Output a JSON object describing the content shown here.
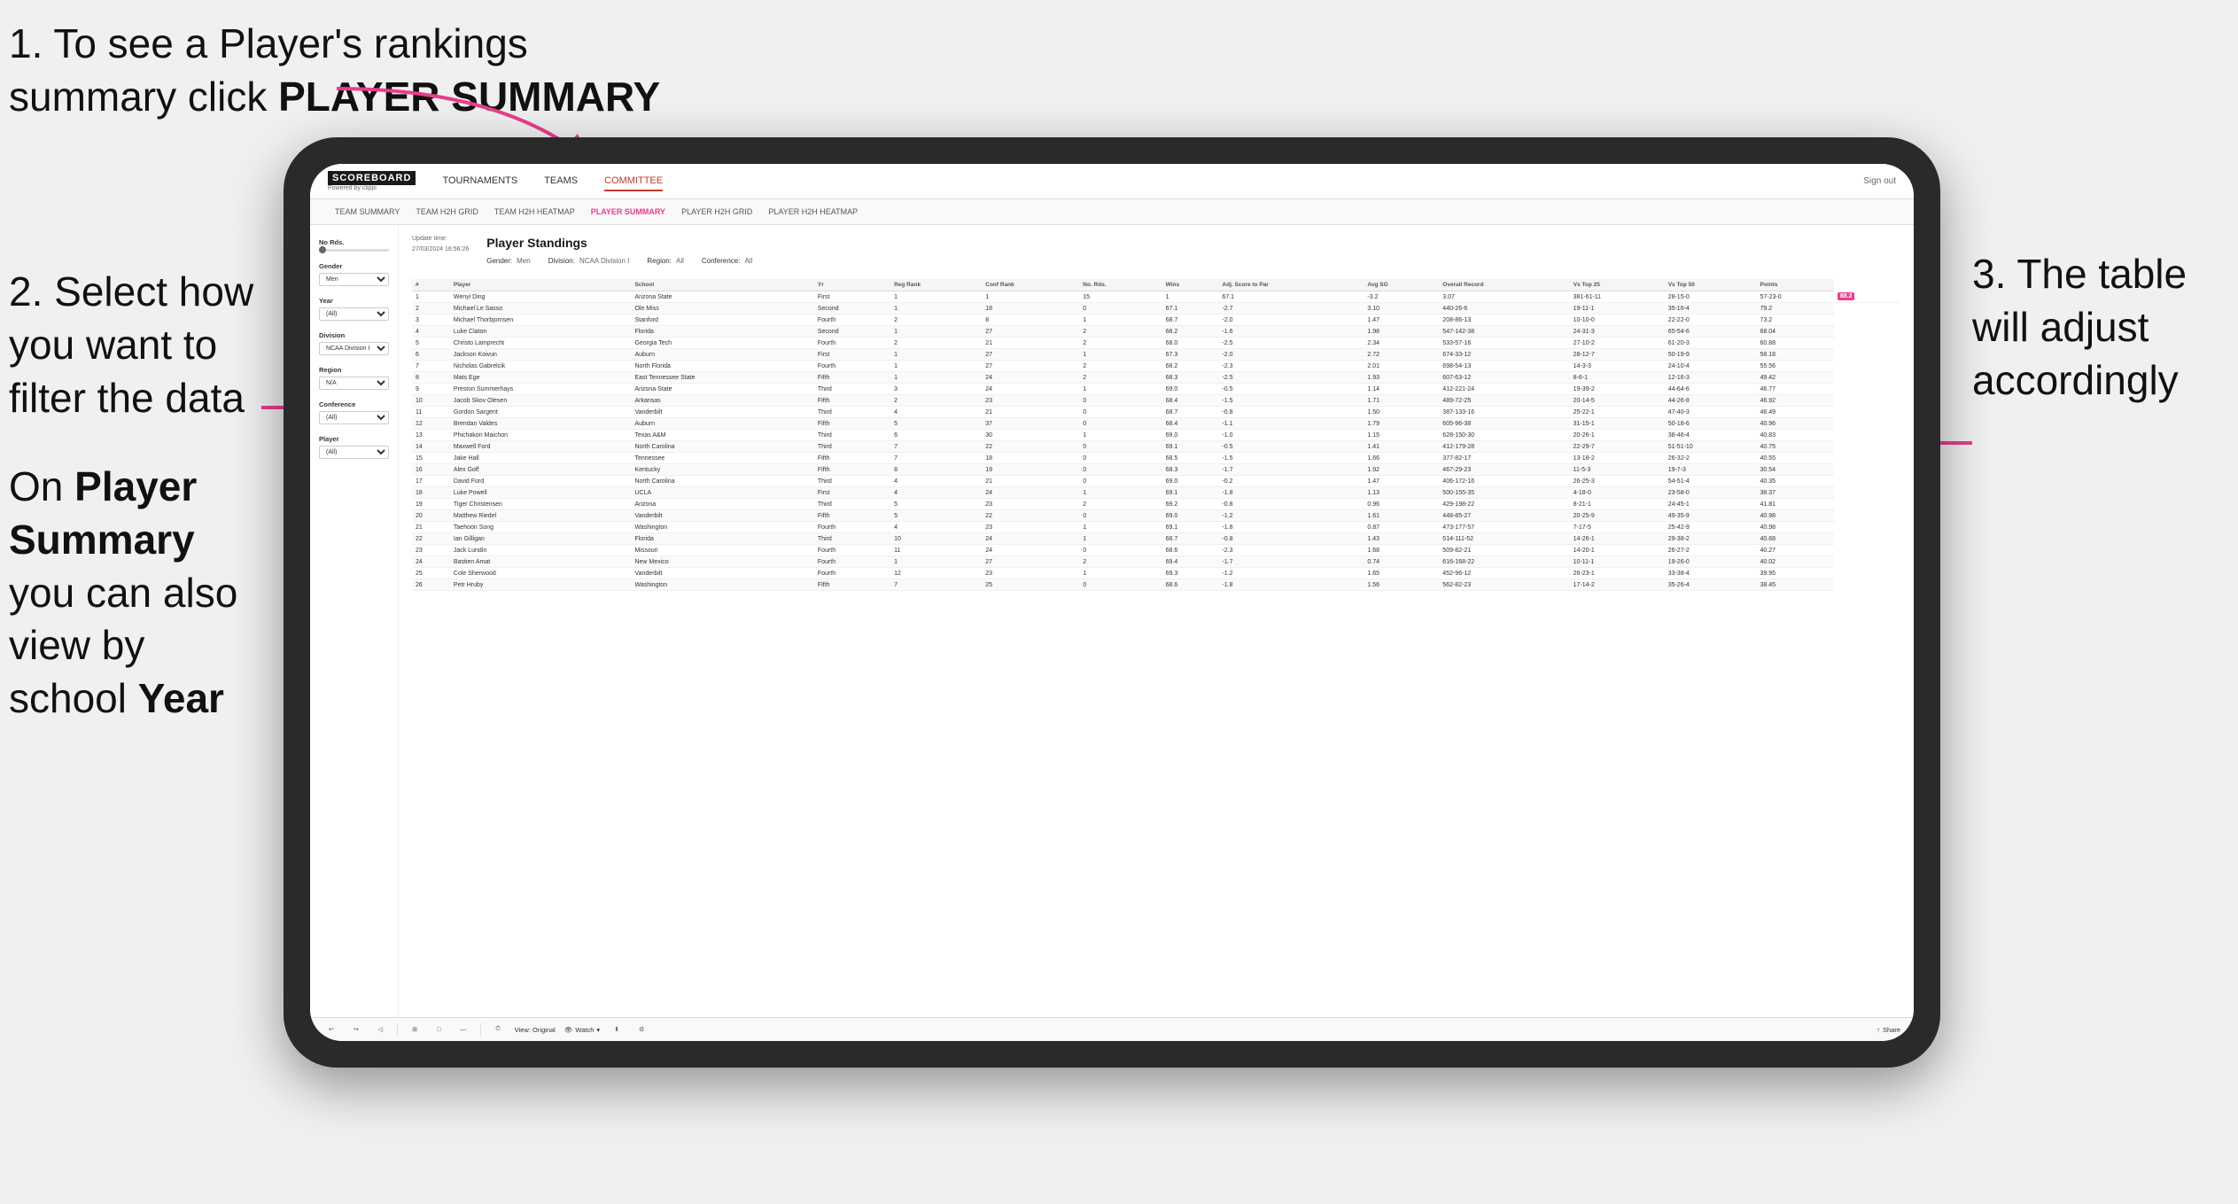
{
  "annotations": {
    "step1": "1. To see a Player's rankings summary click ",
    "step1_bold": "PLAYER SUMMARY",
    "step2_title": "2. Select how you want to filter the data",
    "step3_title": "3. The table will adjust accordingly",
    "bottom_note_prefix": "On ",
    "bottom_note_bold1": "Player Summary",
    "bottom_note_mid": " you can also view by school ",
    "bottom_note_bold2": "Year"
  },
  "nav": {
    "logo": "SCOREBOARD",
    "logo_sub": "Powered by clippi",
    "links": [
      "TOURNAMENTS",
      "TEAMS",
      "COMMITTEE"
    ],
    "sign_out": "Sign out"
  },
  "subnav": {
    "links": [
      "TEAM SUMMARY",
      "TEAM H2H GRID",
      "TEAM H2H HEATMAP",
      "PLAYER SUMMARY",
      "PLAYER H2H GRID",
      "PLAYER H2H HEATMAP"
    ]
  },
  "sidebar": {
    "no_rds_label": "No Rds.",
    "gender_label": "Gender",
    "gender_value": "Men",
    "year_label": "Year",
    "year_value": "(All)",
    "division_label": "Division",
    "division_value": "NCAA Division I",
    "region_label": "Region",
    "region_value": "N/A",
    "conference_label": "Conference",
    "conference_value": "(All)",
    "player_label": "Player",
    "player_value": "(All)"
  },
  "table": {
    "update_time": "Update time:",
    "update_date": "27/03/2024 16:56:26",
    "title": "Player Standings",
    "filters": {
      "gender_label": "Gender:",
      "gender_val": "Men",
      "division_label": "Division:",
      "division_val": "NCAA Division I",
      "region_label": "Region:",
      "region_val": "All",
      "conference_label": "Conference:",
      "conference_val": "All"
    },
    "columns": [
      "#",
      "Player",
      "School",
      "Yr",
      "Reg Rank",
      "Conf Rank",
      "No. Rds.",
      "Wins",
      "Adj. Score to Par",
      "Avg SG",
      "Overall Record",
      "Vs Top 25",
      "Vs Top 50",
      "Points"
    ],
    "rows": [
      [
        "1",
        "Wenyi Ding",
        "Arizona State",
        "First",
        "1",
        "1",
        "15",
        "1",
        "67.1",
        "-3.2",
        "3.07",
        "381-61-11",
        "28-15-0",
        "57-23-0",
        "88.2"
      ],
      [
        "2",
        "Michael Le Sasso",
        "Ole Miss",
        "Second",
        "1",
        "18",
        "0",
        "67.1",
        "-2.7",
        "3.10",
        "440-26-6",
        "19-11-1",
        "35-16-4",
        "79.2"
      ],
      [
        "3",
        "Michael Thorbjornsen",
        "Stanford",
        "Fourth",
        "2",
        "8",
        "1",
        "68.7",
        "-2.0",
        "1.47",
        "208-86-13",
        "10-10-0",
        "22-22-0",
        "73.2"
      ],
      [
        "4",
        "Luke Claton",
        "Florida",
        "Second",
        "1",
        "27",
        "2",
        "68.2",
        "-1.6",
        "1.98",
        "547-142-38",
        "24-31-3",
        "65-54-6",
        "68.04"
      ],
      [
        "5",
        "Christo Lamprecht",
        "Georgia Tech",
        "Fourth",
        "2",
        "21",
        "2",
        "68.0",
        "-2.5",
        "2.34",
        "533-57-16",
        "27-10-2",
        "61-20-3",
        "60.88"
      ],
      [
        "6",
        "Jackson Koivun",
        "Auburn",
        "First",
        "1",
        "27",
        "1",
        "67.3",
        "-2.0",
        "2.72",
        "674-33-12",
        "28-12-7",
        "50-19-9",
        "58.18"
      ],
      [
        "7",
        "Nicholas Gabrelcik",
        "North Florida",
        "Fourth",
        "1",
        "27",
        "2",
        "68.2",
        "-2.3",
        "2.01",
        "698-54-13",
        "14-3-3",
        "24-10-4",
        "55.56"
      ],
      [
        "8",
        "Mats Ege",
        "East Tennessee State",
        "Fifth",
        "1",
        "24",
        "2",
        "68.3",
        "-2.5",
        "1.93",
        "607-63-12",
        "8-6-1",
        "12-16-3",
        "49.42"
      ],
      [
        "9",
        "Preston Summerhays",
        "Arizona State",
        "Third",
        "3",
        "24",
        "1",
        "69.0",
        "-0.5",
        "1.14",
        "412-221-24",
        "19-39-2",
        "44-64-6",
        "46.77"
      ],
      [
        "10",
        "Jacob Skov Olesen",
        "Arkansas",
        "Fifth",
        "2",
        "23",
        "0",
        "68.4",
        "-1.5",
        "1.71",
        "489-72-25",
        "20-14-5",
        "44-26-8",
        "46.92"
      ],
      [
        "11",
        "Gordon Sargent",
        "Vanderbilt",
        "Third",
        "4",
        "21",
        "0",
        "68.7",
        "-0.8",
        "1.50",
        "387-133-16",
        "25-22-1",
        "47-40-3",
        "46.49"
      ],
      [
        "12",
        "Brendan Valdes",
        "Auburn",
        "Fifth",
        "5",
        "37",
        "0",
        "68.4",
        "-1.1",
        "1.79",
        "605-96-38",
        "31-15-1",
        "50-18-6",
        "40.96"
      ],
      [
        "13",
        "Phichakon Maichon",
        "Texas A&M",
        "Third",
        "6",
        "30",
        "1",
        "69.0",
        "-1.0",
        "1.15",
        "628-150-30",
        "20-26-1",
        "38-46-4",
        "40.83"
      ],
      [
        "14",
        "Maxwell Ford",
        "North Carolina",
        "Third",
        "7",
        "22",
        "0",
        "69.1",
        "-0.5",
        "1.41",
        "412-179-28",
        "22-29-7",
        "51-51-10",
        "40.75"
      ],
      [
        "15",
        "Jake Hall",
        "Tennessee",
        "Fifth",
        "7",
        "18",
        "0",
        "68.5",
        "-1.5",
        "1.66",
        "377-82-17",
        "13-18-2",
        "26-32-2",
        "40.55"
      ],
      [
        "16",
        "Alex Goff",
        "Kentucky",
        "Fifth",
        "8",
        "19",
        "0",
        "68.3",
        "-1.7",
        "1.92",
        "467-29-23",
        "11-5-3",
        "19-7-3",
        "30.54"
      ],
      [
        "17",
        "David Ford",
        "North Carolina",
        "Third",
        "4",
        "21",
        "0",
        "69.0",
        "-0.2",
        "1.47",
        "406-172-16",
        "26-25-3",
        "54-51-4",
        "40.35"
      ],
      [
        "18",
        "Luke Powell",
        "UCLA",
        "First",
        "4",
        "24",
        "1",
        "69.1",
        "-1.8",
        "1.13",
        "500-155-35",
        "4-18-0",
        "23-58-0",
        "38.37"
      ],
      [
        "19",
        "Tiger Christensen",
        "Arizona",
        "Third",
        "5",
        "23",
        "2",
        "69.2",
        "-0.8",
        "0.96",
        "429-198-22",
        "8-21-1",
        "24-45-1",
        "41.81"
      ],
      [
        "20",
        "Matthew Riedel",
        "Vanderbilt",
        "Fifth",
        "5",
        "22",
        "0",
        "69.0",
        "-1.2",
        "1.61",
        "448-85-27",
        "20-25-9",
        "49-35-9",
        "40.98"
      ],
      [
        "21",
        "Taehoon Song",
        "Washington",
        "Fourth",
        "4",
        "23",
        "1",
        "69.1",
        "-1.8",
        "0.87",
        "473-177-57",
        "7-17-5",
        "25-42-9",
        "40.98"
      ],
      [
        "22",
        "Ian Gilligan",
        "Florida",
        "Third",
        "10",
        "24",
        "1",
        "68.7",
        "-0.8",
        "1.43",
        "514-111-52",
        "14-26-1",
        "29-38-2",
        "40.68"
      ],
      [
        "23",
        "Jack Lundin",
        "Missouri",
        "Fourth",
        "11",
        "24",
        "0",
        "68.6",
        "-2.3",
        "1.68",
        "509-82-21",
        "14-20-1",
        "26-27-2",
        "40.27"
      ],
      [
        "24",
        "Bastien Amat",
        "New Mexico",
        "Fourth",
        "1",
        "27",
        "2",
        "69.4",
        "-1.7",
        "0.74",
        "616-168-22",
        "10-11-1",
        "19-26-0",
        "40.02"
      ],
      [
        "25",
        "Cole Sherwood",
        "Vanderbilt",
        "Fourth",
        "12",
        "23",
        "1",
        "69.3",
        "-1.2",
        "1.65",
        "452-96-12",
        "26-23-1",
        "33-38-4",
        "39.95"
      ],
      [
        "26",
        "Petr Hruby",
        "Washington",
        "Fifth",
        "7",
        "25",
        "0",
        "68.6",
        "-1.8",
        "1.56",
        "562-82-23",
        "17-14-2",
        "35-26-4",
        "38.45"
      ]
    ]
  },
  "toolbar": {
    "view_label": "View: Original",
    "watch_label": "Watch",
    "share_label": "Share"
  }
}
